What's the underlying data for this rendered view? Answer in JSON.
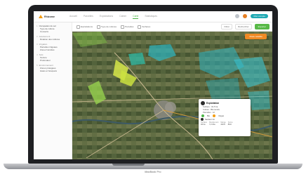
{
  "app": {
    "logo_text": "Rhizome",
    "nav": [
      "Accueil",
      "Parcelles",
      "Exploitations",
      "Cahier",
      "Carte",
      "Statistiques"
    ],
    "active_nav_index": 4,
    "account_label": "Mon compte",
    "brand_color": "#4cb648",
    "accent_color": "#f08a24"
  },
  "sidebar": {
    "items": [
      {
        "num": "1",
        "label": "Occupation du sol",
        "subs": [
          "Type de culture",
          "Couverts"
        ]
      },
      {
        "num": "2",
        "label": "Assolement",
        "subs": [
          "Rotation des cultures"
        ]
      },
      {
        "num": "3",
        "label": "Irrigation",
        "subs": [
          "Parcelles irriguées",
          "Zones humides"
        ]
      },
      {
        "num": "4",
        "label": "Sols",
        "subs": [
          "Texture",
          "Profondeur"
        ]
      },
      {
        "num": "5",
        "label": "Environnement",
        "subs": [
          "Zones protégées",
          "Haies et bosquets"
        ]
      }
    ]
  },
  "toolbar": {
    "filters": [
      "Exploitations",
      "Type de cultures",
      "Parcelles",
      "Surfaces"
    ],
    "btn_a": "Filtrer",
    "btn_b": "Rechercher",
    "primary_btn": "Exporter"
  },
  "map": {
    "overlay_btn": "Mode satellite"
  },
  "popup": {
    "title": "Exploitation",
    "lines": [
      "Surface : 32,5 ha",
      "Culture : Blé tendre",
      "Parcelles : 12"
    ],
    "chip_a": "Bio",
    "chip_b": "Irrigué",
    "sub_title": "Secteur 14",
    "table_head": [
      "Surface",
      "Rendement",
      "Marge",
      "Score"
    ],
    "table_row": [
      "32 ha",
      "7,2 t/ha",
      "410 €",
      "8/10"
    ]
  },
  "device": {
    "label": "MacBook Pro"
  }
}
